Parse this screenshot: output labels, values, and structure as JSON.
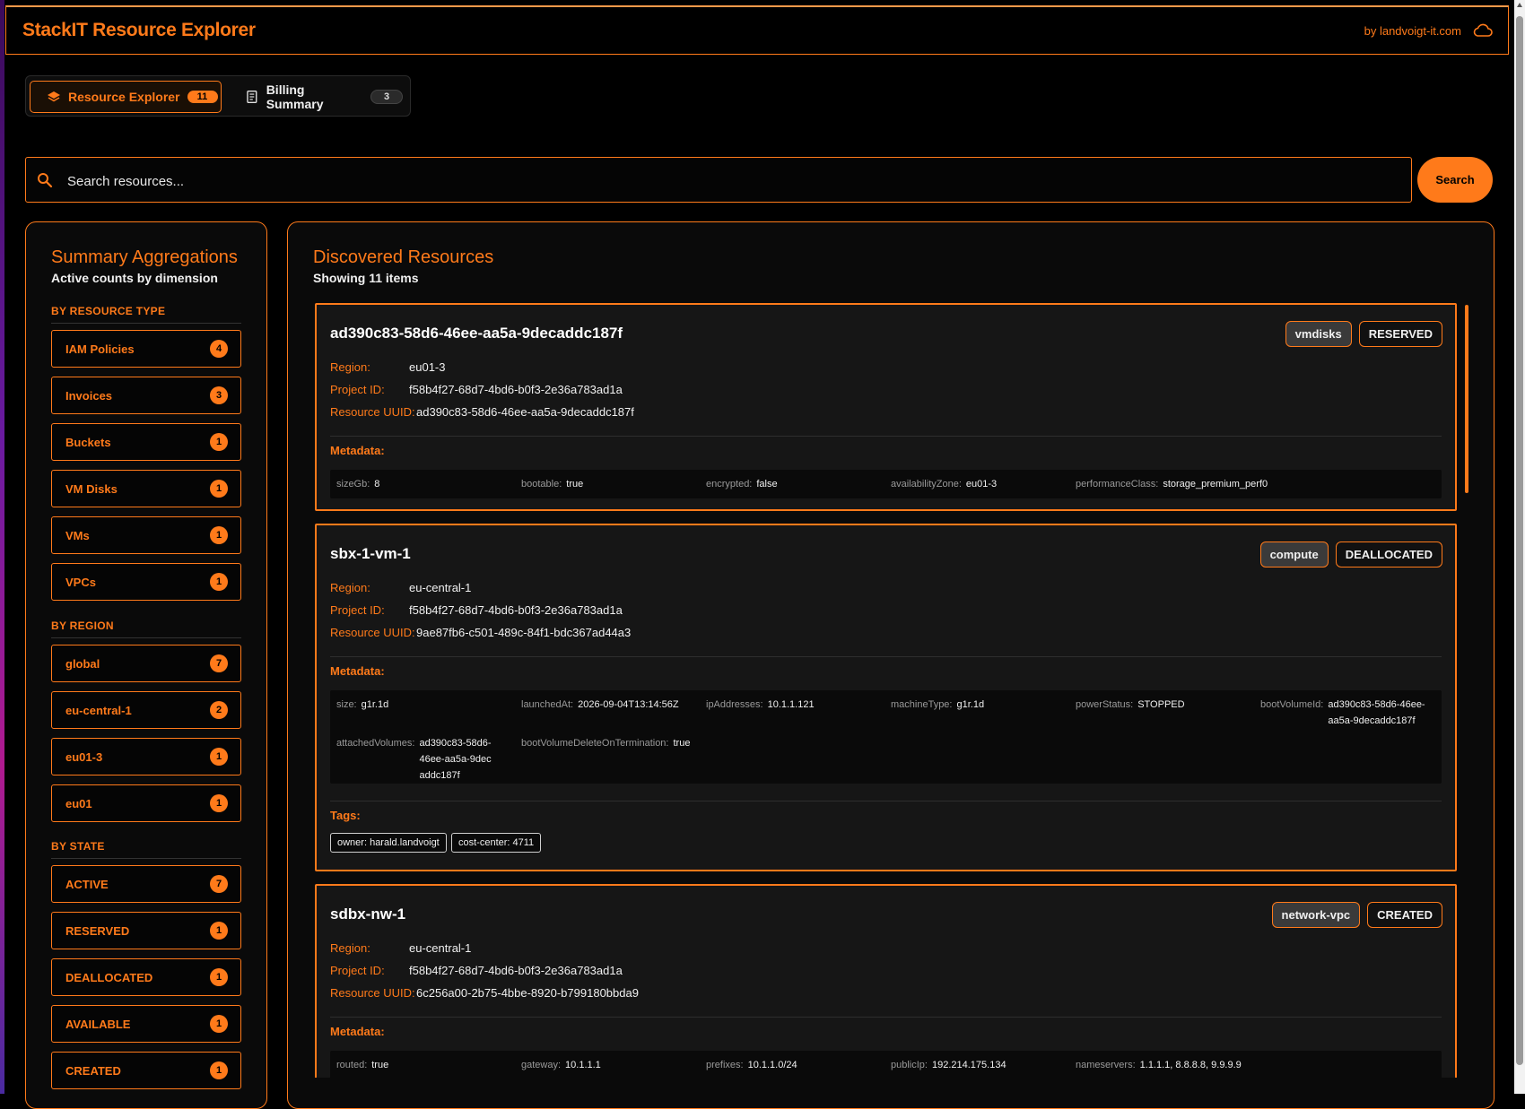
{
  "app": {
    "title": "StackIT Resource Explorer",
    "byline": "by landvoigt-it.com",
    "accent_color": "#ff7a1a"
  },
  "tabs": [
    {
      "label": "Resource Explorer",
      "count": "11",
      "icon": "layers-icon",
      "active": true
    },
    {
      "label": "Billing Summary",
      "count": "3",
      "icon": "receipt-icon",
      "active": false
    }
  ],
  "search": {
    "placeholder": "Search resources...",
    "value": "",
    "button_label": "Search"
  },
  "summary": {
    "title": "Summary Aggregations",
    "subtitle": "Active counts by dimension",
    "groups": [
      {
        "label": "BY RESOURCE TYPE",
        "items": [
          {
            "label": "IAM Policies",
            "count": "4"
          },
          {
            "label": "Invoices",
            "count": "3"
          },
          {
            "label": "Buckets",
            "count": "1"
          },
          {
            "label": "VM Disks",
            "count": "1"
          },
          {
            "label": "VMs",
            "count": "1"
          },
          {
            "label": "VPCs",
            "count": "1"
          }
        ]
      },
      {
        "label": "BY REGION",
        "items": [
          {
            "label": "global",
            "count": "7"
          },
          {
            "label": "eu-central-1",
            "count": "2"
          },
          {
            "label": "eu01-3",
            "count": "1"
          },
          {
            "label": "eu01",
            "count": "1"
          }
        ]
      },
      {
        "label": "BY STATE",
        "items": [
          {
            "label": "ACTIVE",
            "count": "7"
          },
          {
            "label": "RESERVED",
            "count": "1"
          },
          {
            "label": "DEALLOCATED",
            "count": "1"
          },
          {
            "label": "AVAILABLE",
            "count": "1"
          },
          {
            "label": "CREATED",
            "count": "1"
          }
        ]
      }
    ]
  },
  "resources": {
    "title": "Discovered Resources",
    "subtitle": "Showing 11 items",
    "labels": {
      "region": "Region:",
      "project": "Project ID:",
      "uuid": "Resource UUID:",
      "metadata": "Metadata:",
      "tags": "Tags:"
    },
    "items": [
      {
        "name": "ad390c83-58d6-46ee-aa5a-9decaddc187f",
        "type": "vmdisks",
        "state": "RESERVED",
        "region": "eu01-3",
        "project_id": "f58b4f27-68d7-4bd6-b0f3-2e36a783ad1a",
        "uuid": "ad390c83-58d6-46ee-aa5a-9decaddc187f",
        "metadata": [
          {
            "k": "sizeGb:",
            "v": "8"
          },
          {
            "k": "bootable:",
            "v": "true"
          },
          {
            "k": "encrypted:",
            "v": "false"
          },
          {
            "k": "availabilityZone:",
            "v": "eu01-3"
          },
          {
            "k": "performanceClass:",
            "v": "storage_premium_perf0"
          }
        ],
        "tags": []
      },
      {
        "name": "sbx-1-vm-1",
        "type": "compute",
        "state": "DEALLOCATED",
        "region": "eu-central-1",
        "project_id": "f58b4f27-68d7-4bd6-b0f3-2e36a783ad1a",
        "uuid": "9ae87fb6-c501-489c-84f1-bdc367ad44a3",
        "metadata": [
          {
            "k": "size:",
            "v": "g1r.1d"
          },
          {
            "k": "launchedAt:",
            "v": "2026-09-04T13:14:56Z"
          },
          {
            "k": "ipAddresses:",
            "v": "10.1.1.121"
          },
          {
            "k": "machineType:",
            "v": "g1r.1d"
          },
          {
            "k": "powerStatus:",
            "v": "STOPPED"
          },
          {
            "k": "bootVolumeId:",
            "v": "ad390c83-58d6-46ee-aa5a-9decaddc187f"
          },
          {
            "k": "attachedVolumes:",
            "v": "ad390c83-58d6-46ee-aa5a-9decaddc187f"
          },
          {
            "k": "bootVolumeDeleteOnTermination:",
            "v": "true"
          }
        ],
        "tags": [
          "owner: harald.landvoigt",
          "cost-center: 4711"
        ]
      },
      {
        "name": "sdbx-nw-1",
        "type": "network-vpc",
        "state": "CREATED",
        "region": "eu-central-1",
        "project_id": "f58b4f27-68d7-4bd6-b0f3-2e36a783ad1a",
        "uuid": "6c256a00-2b75-4bbe-8920-b799180bbda9",
        "metadata": [
          {
            "k": "routed:",
            "v": "true"
          },
          {
            "k": "gateway:",
            "v": "10.1.1.1"
          },
          {
            "k": "prefixes:",
            "v": "10.1.1.0/24"
          },
          {
            "k": "publicIp:",
            "v": "192.214.175.134"
          },
          {
            "k": "nameservers:",
            "v": "1.1.1.1, 8.8.8.8, 9.9.9.9"
          }
        ],
        "tags": []
      }
    ]
  }
}
